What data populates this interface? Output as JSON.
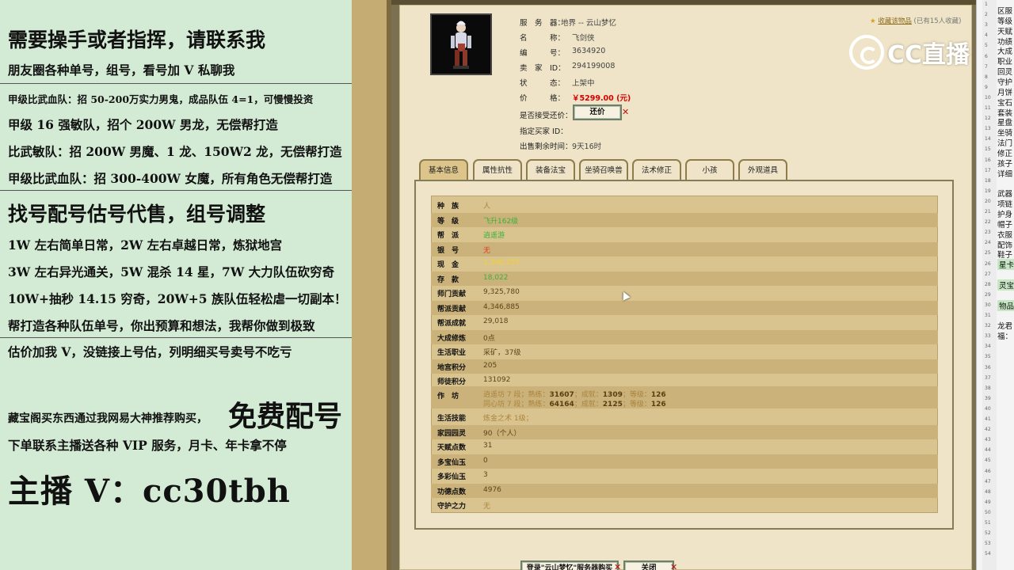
{
  "overlay": {
    "l1": "需要操手或者指挥，请联系我",
    "l2": "朋友圈各种单号，组号，看号加 V 私聊我",
    "l3": "甲级比武血队：招 50-200万实力男鬼，成品队伍 4=1，可慢慢投资",
    "l4": "甲级 16 强敏队，招个 200W 男龙，无偿帮打造",
    "l5": "比武敏队：招 200W 男魔、1 龙、150W2 龙，无偿帮打造",
    "l6": "甲级比武血队：招 300-400W 女魔，所有角色无偿帮打造",
    "l7": "找号配号估号代售，组号调整",
    "l8": "1W 左右简单日常，2W 左右卓越日常，炼狱地宫",
    "l9": "3W 左右异光通关，5W 混杀 14 星，7W 大力队伍砍穷奇",
    "l10": "10W+抽秒 14.15 穷奇，20W+5 族队伍轻松虐一切副本！",
    "l11": "帮打造各种队伍单号，你出预算和想法，我帮你做到极致",
    "l12": "估价加我 V，没链接上号估，列明细买号卖号不吃亏",
    "l13": "藏宝阁买东西通过我网易大神推荐购买，",
    "free": "免费配号",
    "l14": "下单联系主播送各种 VIP 服务，月卡、年卡拿不停",
    "l15": "主播 V：cc30tbh"
  },
  "info": {
    "server_label": "服　务　器：",
    "server_value": "地界 -- 云山梦忆",
    "name_label": "名　　　称：",
    "name_value": "飞剑侠",
    "id_label": "编　　　号：",
    "id_value": "3634920",
    "seller_label": "卖　家　ID：",
    "seller_value": "294199008",
    "status_label": "状　　　态：",
    "status_value": "上架中",
    "price_label": "价　　　格：",
    "price_value": "￥5299.00 (元)",
    "bargain_label": "是否接受还价：",
    "bargain_btn": "还价",
    "buyer_label": "指定买家 ID：",
    "remain_label": "出售剩余时间：",
    "remain_value": "9天16时",
    "fav_link": "收藏该物品",
    "fav_count": "(已有15人收藏)"
  },
  "tabs": [
    "基本信息",
    "属性抗性",
    "装备法宝",
    "坐骑召唤兽",
    "法术修正",
    "小孩",
    "外观道具"
  ],
  "rows": [
    {
      "k": "种　族",
      "v": "人",
      "c": "brn"
    },
    {
      "k": "等　级",
      "v": "飞升162级",
      "c": "grn"
    },
    {
      "k": "帮　派",
      "v": "逍遥游",
      "c": "grn"
    },
    {
      "k": "银　号",
      "v": "无",
      "c": "red"
    },
    {
      "k": "现　金",
      "v": "1,340,257",
      "c": "ylw"
    },
    {
      "k": "存　款",
      "v": "18,022",
      "c": "grn"
    },
    {
      "k": "师门贡献",
      "v": "9,325,780",
      "c": ""
    },
    {
      "k": "帮派贡献",
      "v": "4,346,885",
      "c": ""
    },
    {
      "k": "帮派成就",
      "v": "29,018",
      "c": ""
    },
    {
      "k": "大成修炼",
      "v": "0点",
      "c": ""
    },
    {
      "k": "生活职业",
      "v": "采矿，37级",
      "c": ""
    },
    {
      "k": "地宫积分",
      "v": "205",
      "c": ""
    },
    {
      "k": "师徒积分",
      "v": "131092",
      "c": ""
    }
  ],
  "workshop": {
    "k": "作　坊",
    "a1": "逍遥坊 7 段；",
    "a2": "熟练：",
    "a3": "31607",
    "a4": "；成就：",
    "a5": "1309",
    "a6": "；等级：",
    "a7": "126",
    "b1": "同心坊 7 段；",
    "b2": "熟练：",
    "b3": "64164",
    "b4": "；成就：",
    "b5": "2125",
    "b6": "；等级：",
    "b7": "126"
  },
  "rows2": [
    {
      "k": "生活技能",
      "v": "炼金之术 1级；",
      "c": "brn"
    },
    {
      "k": "家园园灵",
      "v": "90（个人）",
      "c": ""
    },
    {
      "k": "天赋点数",
      "v": "31",
      "c": ""
    },
    {
      "k": "多宝仙玉",
      "v": "0",
      "c": ""
    },
    {
      "k": "多彩仙玉",
      "v": "3",
      "c": ""
    },
    {
      "k": "功德点数",
      "v": "4976",
      "c": ""
    },
    {
      "k": "守护之力",
      "v": "无",
      "c": "brn"
    }
  ],
  "bottom": {
    "login_btn": "登录\"云山梦忆\"服务器购买",
    "close_btn": "关闭"
  },
  "sheet": {
    "cells": [
      "区服",
      "等级",
      "天赋",
      "功绩",
      "大成",
      "职业",
      "回灵",
      "守护",
      "月饼",
      "宝石",
      "套装",
      "星盘",
      "坐骑",
      "法门",
      "修正",
      "孩子",
      "详细",
      "",
      "武器",
      "项链",
      "护身",
      "帽子",
      "衣服",
      "配饰",
      "鞋子",
      "星卡",
      "",
      "灵宝",
      "",
      "物品",
      "",
      "龙君",
      "福："
    ],
    "nums": [
      "1",
      "2",
      "3",
      "4",
      "5",
      "6",
      "7",
      "8",
      "9",
      "10",
      "11",
      "12",
      "13",
      "14",
      "15",
      "16",
      "17",
      "18",
      "19",
      "20",
      "21",
      "22",
      "23",
      "24",
      "25",
      "26",
      "27",
      "28",
      "29",
      "30",
      "31",
      "32",
      "33",
      "34",
      "35",
      "36",
      "37",
      "38",
      "39",
      "40",
      "41",
      "42",
      "43",
      "44",
      "45",
      "46",
      "47",
      "48",
      "49",
      "50",
      "51",
      "52",
      "53",
      "54"
    ]
  },
  "watermark": "CC直播",
  "colors": {
    "overlay_bg": "#d3ebd4",
    "paper_bg": "#efe4c7",
    "table_bg": "#d9c490",
    "price": "#d40000"
  }
}
